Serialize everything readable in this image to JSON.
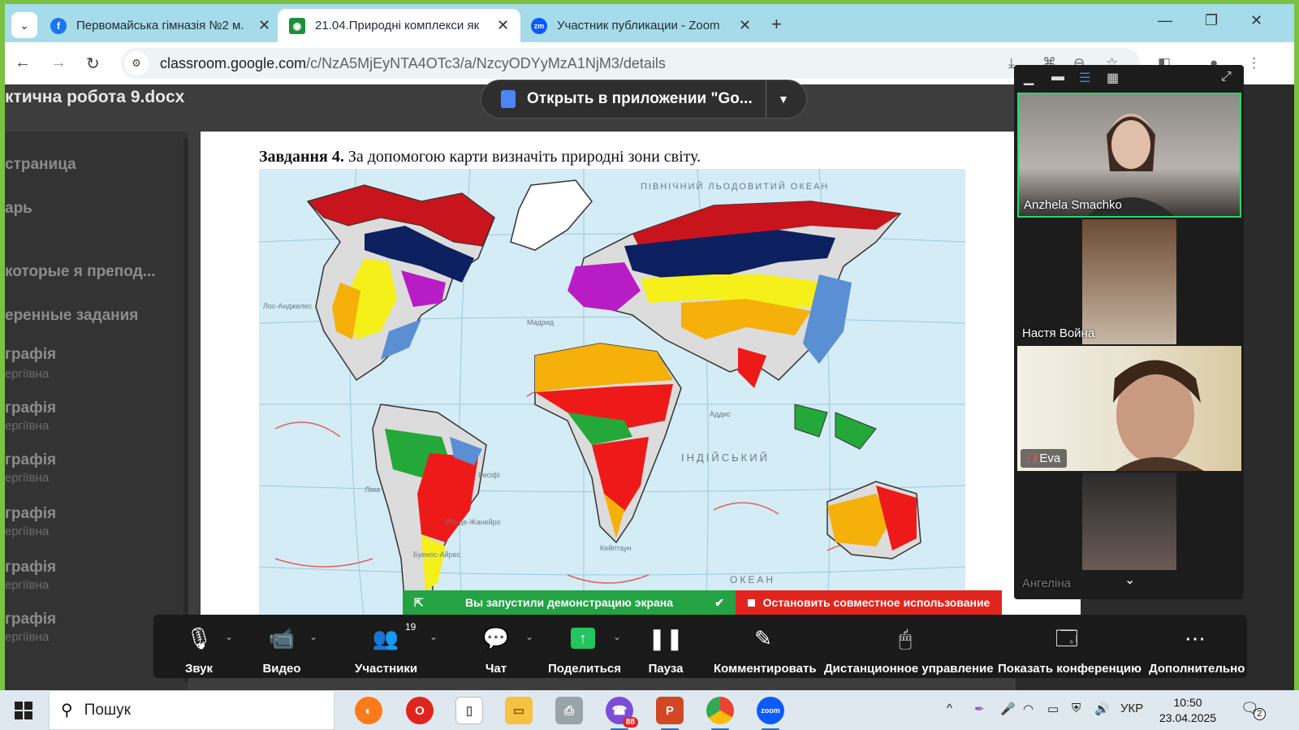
{
  "browser": {
    "tabs": [
      {
        "title": "Первомайська гімназія №2 м.",
        "icon": "facebook-icon",
        "color": "#1877f2",
        "glyph": "f"
      },
      {
        "title": "21.04.Природні комплекси як",
        "icon": "classroom-icon",
        "color": "#1e8e3e",
        "glyph": "C"
      },
      {
        "title": "Участник публикации - Zoom",
        "icon": "zoom-icon",
        "color": "#0b5cff",
        "glyph": "zm"
      }
    ],
    "url_host": "classroom.google.com",
    "url_path": "/c/NzA5MjEyNTA4OTc3/a/NzcyODYyMzA1NjM3/details"
  },
  "viewer": {
    "doc_title": "ктична робота 9.docx",
    "open_in_app": "Открыть в приложении \"Go...",
    "sidebar": [
      {
        "label": "страница"
      },
      {
        "label": "арь"
      },
      {
        "label": "которые я препод..."
      },
      {
        "label": "еренные задания"
      },
      {
        "label": "графія",
        "sub": "ергіївна"
      },
      {
        "label": "графія",
        "sub": "ергіївна"
      },
      {
        "label": "графія",
        "sub": "ергіївна"
      },
      {
        "label": "графія",
        "sub": "ергіївна"
      },
      {
        "label": "графія",
        "sub": "ергіївна"
      },
      {
        "label": "графія",
        "sub": "ергіївна"
      }
    ],
    "task_bold": "Завдання 4.",
    "task_text": " За допомогою карти визначіть природні зони світу."
  },
  "map": {
    "labels": {
      "arctic": "ПІВНІЧНИЙ ЛЬОДОВИТИЙ ОКЕАН",
      "indian": "ІНДІЙСЬКИЙ",
      "ocean": "ОКЕАН",
      "los_angeles": "Лос-Анджелес",
      "madrid": "Мадрид",
      "lima": "Ліма",
      "recife": "Ресіфі",
      "rio": "Ріо-де-Жанейро",
      "buenos": "Буенос-Айрес",
      "capetown": "Кейптаун",
      "addis": "Аддис"
    },
    "zone_colors": {
      "tundra": "#c8141c",
      "taiga": "#0c2060",
      "mixed_forest": "#b81cc4",
      "steppe": "#f5f01a",
      "desert": "#f5b00a",
      "savanna": "#ee1a1a",
      "rainforest": "#25a83a",
      "monsoon": "#5a8fd4",
      "ice": "#ffffff",
      "highland": "#dcdcdc",
      "mediterranean": "#6a2aa0"
    }
  },
  "zoom": {
    "participants": [
      {
        "name": "Anzhela Smachko",
        "muted": false
      },
      {
        "name": "Настя Война",
        "muted": false
      },
      {
        "name": "Eva",
        "muted": true
      },
      {
        "name": "Ангеліна",
        "muted": true
      }
    ],
    "share_banner": "Вы запустили демонстрацию экрана",
    "stop_share": "Остановить совместное использование",
    "toolbar": {
      "audio": "Звук",
      "video": "Видео",
      "participants": "Участники",
      "participants_count": "19",
      "chat": "Чат",
      "share": "Поделиться",
      "pause": "Пауза",
      "annotate": "Комментировать",
      "remote": "Дистанционное управление",
      "show_conf": "Показать конференцию",
      "more": "Дополнительно"
    }
  },
  "taskbar": {
    "search_placeholder": "Пошук",
    "lang": "УКР",
    "time": "10:50",
    "date": "23.04.2025",
    "notif_count": "2",
    "viber_badge": "88"
  }
}
